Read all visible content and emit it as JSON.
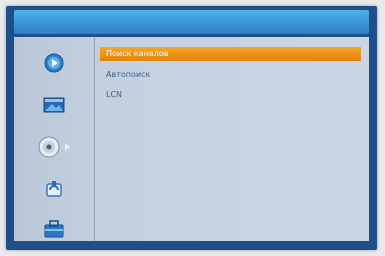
{
  "window": {
    "title": ""
  },
  "sidebar": {
    "icons": [
      {
        "name": "play-icon"
      },
      {
        "name": "picture-icon"
      },
      {
        "name": "disc-icon"
      },
      {
        "name": "tools-icon"
      },
      {
        "name": "briefcase-icon"
      }
    ],
    "active_index": 2
  },
  "menu": {
    "items": [
      {
        "label": "Поиск каналов",
        "selected": true
      },
      {
        "label": "Автопоиск",
        "selected": false
      },
      {
        "label": "LCN",
        "selected": false
      }
    ]
  },
  "colors": {
    "frame": "#1e4f88",
    "title_bar": "#3d97d8",
    "highlight": "#f0981a",
    "menu_text": "#3c5e8c"
  }
}
